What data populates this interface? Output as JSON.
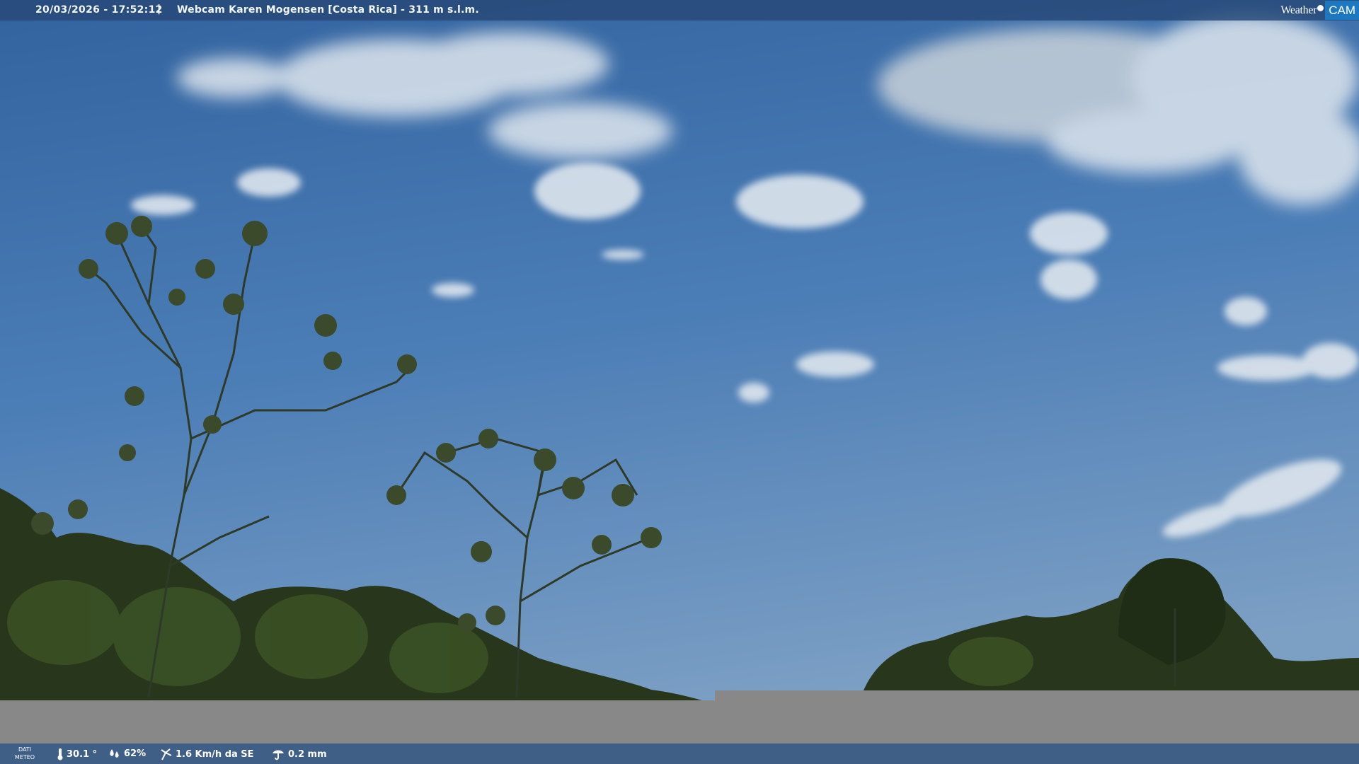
{
  "header": {
    "datetime": "20/03/2026 - 17:52:12",
    "separator": "|",
    "title": "Webcam Karen Mogensen [Costa Rica]  - 311 m s.l.m.",
    "logo": {
      "text_weather": "Weather",
      "text_cam": "CAM"
    }
  },
  "footer": {
    "dati_line1": "DATI",
    "dati_line2": "METEO",
    "temperature": "30.1 °",
    "humidity": "62%",
    "wind": "1.6 Km/h da SE",
    "rain": "0.2 mm"
  },
  "colors": {
    "bar_top": "#264876",
    "bar_bottom": "#3f5f87",
    "logo_accent": "#1d78c2",
    "sky": "#4f7fb6"
  },
  "icons": [
    "thermometer-icon",
    "humidity-icon",
    "wind-icon",
    "rain-icon"
  ]
}
